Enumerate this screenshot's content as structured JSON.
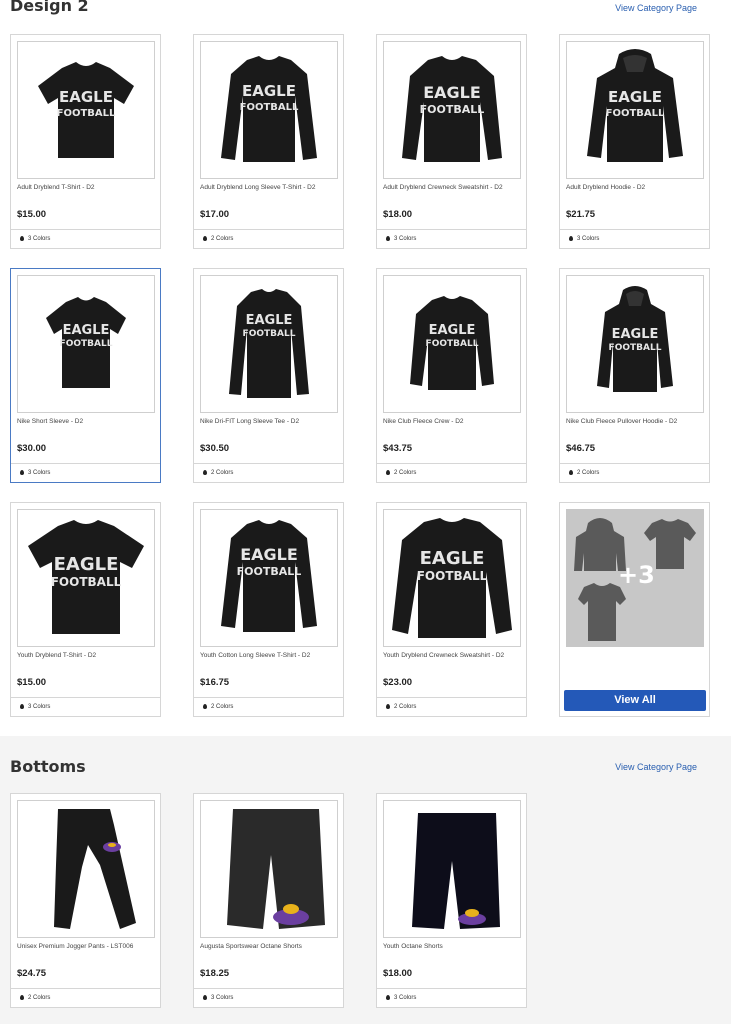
{
  "sections": {
    "design": {
      "title": "Design 2",
      "view_category": "View Category Page",
      "products": [
        {
          "name": "Adult Dryblend T-Shirt - D2",
          "price": "$15.00",
          "colors": "3 Colors",
          "icon": "tshirt-icon"
        },
        {
          "name": "Adult Dryblend Long Sleeve T-Shirt - D2",
          "price": "$17.00",
          "colors": "2 Colors",
          "icon": "longsleeve-icon"
        },
        {
          "name": "Adult Dryblend Crewneck Sweatshirt - D2",
          "price": "$18.00",
          "colors": "3 Colors",
          "icon": "crewneck-icon"
        },
        {
          "name": "Adult Dryblend Hoodie - D2",
          "price": "$21.75",
          "colors": "3 Colors",
          "icon": "hoodie-icon"
        },
        {
          "name": "Nike Short Sleeve - D2",
          "price": "$30.00",
          "colors": "3 Colors",
          "icon": "tshirt-icon"
        },
        {
          "name": "Nike Dri-FIT Long Sleeve Tee - D2",
          "price": "$30.50",
          "colors": "2 Colors",
          "icon": "longsleeve-icon"
        },
        {
          "name": "Nike Club Fleece Crew - D2",
          "price": "$43.75",
          "colors": "2 Colors",
          "icon": "crewneck-icon"
        },
        {
          "name": "Nike Club Fleece Pullover Hoodie - D2",
          "price": "$46.75",
          "colors": "2 Colors",
          "icon": "hoodie-icon"
        },
        {
          "name": "Youth Dryblend T-Shirt - D2",
          "price": "$15.00",
          "colors": "3 Colors",
          "icon": "tshirt-icon"
        },
        {
          "name": "Youth Cotton Long Sleeve T-Shirt - D2",
          "price": "$16.75",
          "colors": "2 Colors",
          "icon": "longsleeve-icon"
        },
        {
          "name": "Youth Dryblend Crewneck Sweatshirt - D2",
          "price": "$23.00",
          "colors": "2 Colors",
          "icon": "crewneck-icon"
        }
      ],
      "view_all": {
        "more_count": "+3",
        "button_label": "View All"
      }
    },
    "bottoms": {
      "title": "Bottoms",
      "view_category": "View Category Page",
      "products": [
        {
          "name": "Unisex Premium Jogger Pants - LST006",
          "price": "$24.75",
          "colors": "2 Colors",
          "icon": "jogger-pants-icon"
        },
        {
          "name": "Augusta Sportswear Octane Shorts",
          "price": "$18.25",
          "colors": "3 Colors",
          "icon": "shorts-icon"
        },
        {
          "name": "Youth Octane Shorts",
          "price": "$18.00",
          "colors": "3 Colors",
          "icon": "shorts-icon"
        }
      ]
    }
  },
  "print": {
    "line1": "EAGLE",
    "line2": "FOOTBALL"
  },
  "colors": {
    "accent": "#2459b8",
    "link": "#2a5fb0",
    "garment": "#1a1a1a",
    "logo_purple": "#6b3fa0",
    "logo_gold": "#e8b21b"
  }
}
